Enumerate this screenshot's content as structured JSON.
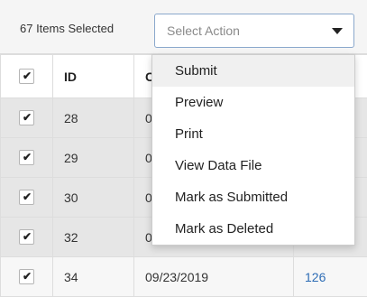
{
  "toolbar": {
    "selected_label": "67 Items Selected",
    "action_select_placeholder": "Select Action"
  },
  "dropdown": {
    "items": [
      "Submit",
      "Preview",
      "Print",
      "View Data File",
      "Mark as Submitted",
      "Mark as Deleted"
    ]
  },
  "table": {
    "headers": {
      "id": "ID",
      "col3": "C"
    },
    "rows": [
      {
        "id": "28",
        "date": "0",
        "ref": ""
      },
      {
        "id": "29",
        "date": "0",
        "ref": ""
      },
      {
        "id": "30",
        "date": "0",
        "ref": ""
      },
      {
        "id": "32",
        "date": "0",
        "ref": ""
      },
      {
        "id": "34",
        "date": "09/23/2019",
        "ref": "126"
      }
    ],
    "check_glyph": "✔"
  },
  "colors": {
    "accent_border": "#8aa8cc",
    "link": "#2d6cb5",
    "row_bg": "#e6e6e6"
  }
}
